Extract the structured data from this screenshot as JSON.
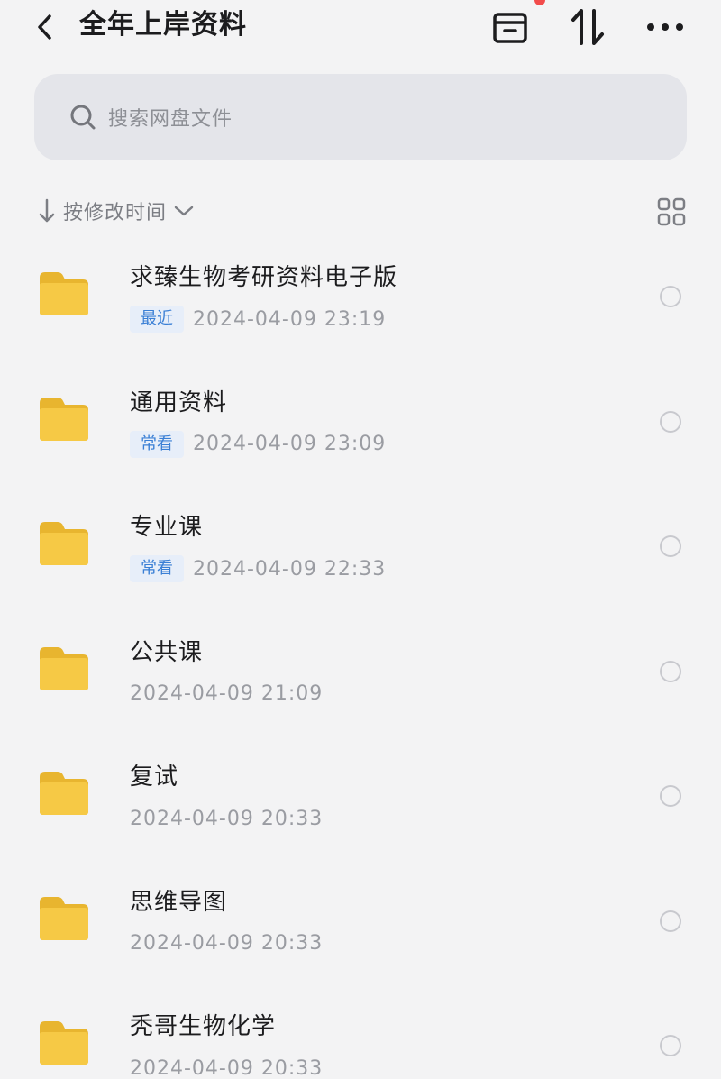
{
  "header": {
    "title": "全年上岸资料",
    "icons": [
      "back-chevron-icon",
      "archive-box-icon",
      "sort-arrows-icon",
      "more-icon"
    ],
    "notification_color": "#f24b4b"
  },
  "search": {
    "placeholder": "搜索网盘文件"
  },
  "sort": {
    "label": "按修改时间"
  },
  "folders": [
    {
      "name": "求臻生物考研资料电子版",
      "tag": "最近",
      "time": "2024-04-09  23:19"
    },
    {
      "name": "通用资料",
      "tag": "常看",
      "time": "2024-04-09  23:09"
    },
    {
      "name": "专业课",
      "tag": "常看",
      "time": "2024-04-09  22:33"
    },
    {
      "name": "公共课",
      "tag": "",
      "time": "2024-04-09  21:09"
    },
    {
      "name": "复试",
      "tag": "",
      "time": "2024-04-09  20:33"
    },
    {
      "name": "思维导图",
      "tag": "",
      "time": "2024-04-09  20:33"
    },
    {
      "name": "秃哥生物化学",
      "tag": "",
      "time": "2024-04-09  20:33"
    }
  ],
  "colors": {
    "folder": "#f6c945",
    "tag_text": "#3a7fd5",
    "tag_bg": "#e7eef9"
  }
}
